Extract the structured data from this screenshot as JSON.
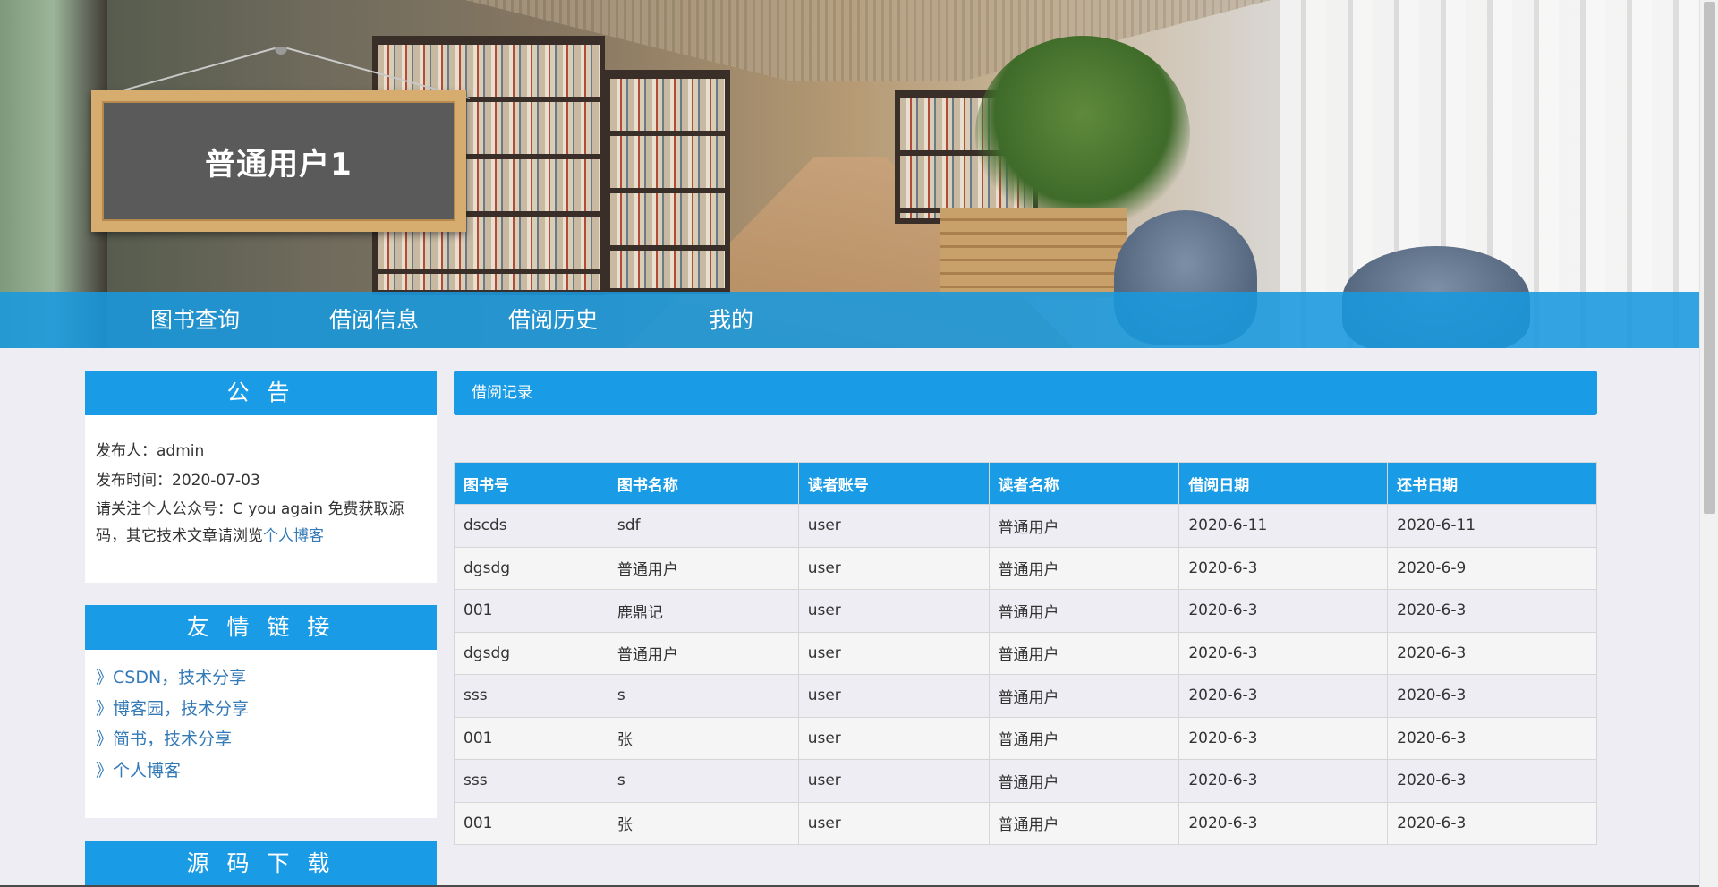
{
  "header": {
    "sign_title": "普通用户1"
  },
  "nav": {
    "items": [
      "图书查询",
      "借阅信息",
      "借阅历史",
      "我的"
    ]
  },
  "notice": {
    "title": "公 告",
    "publisher": "发布人：admin",
    "time": "发布时间：2020-07-03",
    "message": "请关注个人公众号：C you again 免费获取源码，其它技术文章请浏览",
    "link_text": "个人博客"
  },
  "links": {
    "title": "友 情 链 接",
    "items": [
      "》CSDN，技术分享",
      "》博客园，技术分享",
      "》简书，技术分享",
      "》个人博客"
    ]
  },
  "source": {
    "title": "源 码 下 载"
  },
  "records": {
    "title": "借阅记录",
    "columns": [
      "图书号",
      "图书名称",
      "读者账号",
      "读者名称",
      "借阅日期",
      "还书日期"
    ],
    "rows": [
      [
        "dscds",
        "sdf",
        "user",
        "普通用户",
        "2020-6-11",
        "2020-6-11"
      ],
      [
        "dgsdg",
        "普通用户",
        "user",
        "普通用户",
        "2020-6-3",
        "2020-6-9"
      ],
      [
        "001",
        "鹿鼎记",
        "user",
        "普通用户",
        "2020-6-3",
        "2020-6-3"
      ],
      [
        "dgsdg",
        "普通用户",
        "user",
        "普通用户",
        "2020-6-3",
        "2020-6-3"
      ],
      [
        "sss",
        "s",
        "user",
        "普通用户",
        "2020-6-3",
        "2020-6-3"
      ],
      [
        "001",
        "张",
        "user",
        "普通用户",
        "2020-6-3",
        "2020-6-3"
      ],
      [
        "sss",
        "s",
        "user",
        "普通用户",
        "2020-6-3",
        "2020-6-3"
      ],
      [
        "001",
        "张",
        "user",
        "普通用户",
        "2020-6-3",
        "2020-6-3"
      ]
    ]
  },
  "colors": {
    "accent": "#1a9be6",
    "background": "#eeedf3",
    "link": "#337ab7"
  }
}
